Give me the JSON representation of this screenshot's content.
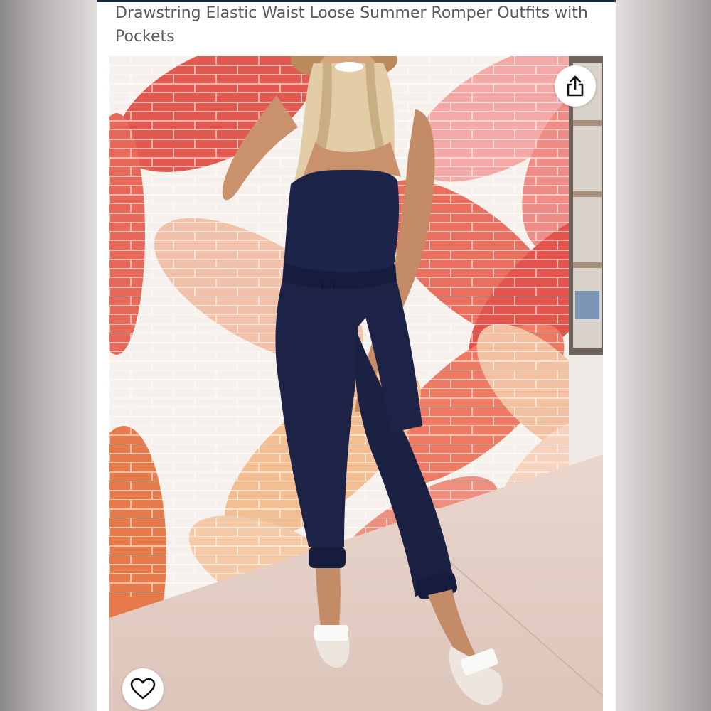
{
  "product": {
    "title": "Drawstring Elastic Waist Loose Summer Romper Outfits with Pockets"
  },
  "image": {
    "subject": "product-photo"
  },
  "actions": {
    "share_icon": "share-icon",
    "wishlist_icon": "heart-outline-icon"
  },
  "colors": {
    "title_text": "#565959",
    "jumpsuit": "#1c2347",
    "wall_red": "#e2594f",
    "wall_peach": "#f2b79a",
    "wall_orange": "#e77a4a",
    "wall_pink": "#f2a3a0"
  }
}
